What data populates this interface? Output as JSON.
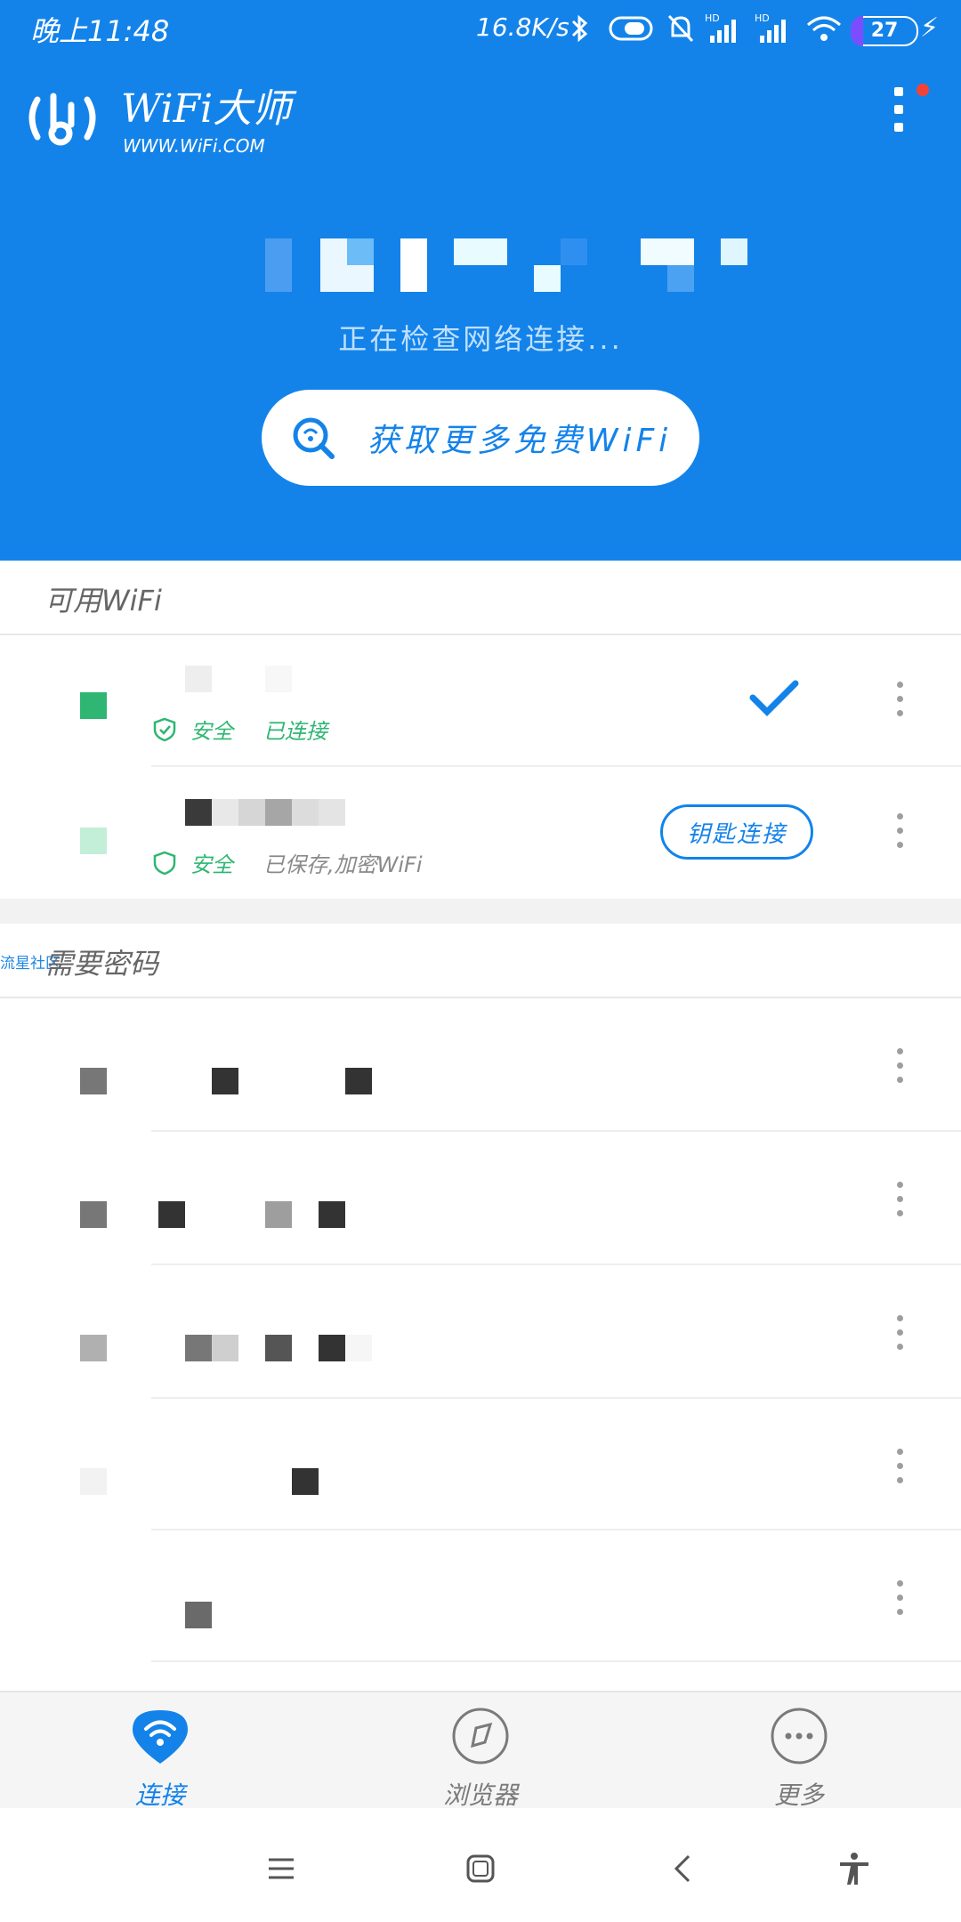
{
  "status_bar": {
    "time": "晚上11:48",
    "net_speed": "16.8K/s",
    "battery_level": "27",
    "icons": [
      "bluetooth-icon",
      "toggle-icon",
      "mute-bell-icon",
      "signal-hd-icon",
      "signal-hd-icon",
      "wifi-icon",
      "battery-icon",
      "charging-icon"
    ]
  },
  "app": {
    "brand": "WiFi大师",
    "url": "WWW.WiFi.COM",
    "checking_text": "正在检查网络连接...",
    "get_more_label": "获取更多免费WiFi"
  },
  "available": {
    "title": "可用WiFi",
    "rows": [
      {
        "status_safe": "安全",
        "status_state": "已连接",
        "connected": true
      },
      {
        "status_safe": "安全",
        "status_state": "已保存,加密WiFi",
        "action_label": "钥匙连接"
      }
    ]
  },
  "password_required": {
    "title": "需要密码",
    "row_count": 5
  },
  "watermark": "流星社区",
  "bottom_nav": {
    "items": [
      {
        "label": "连接",
        "icon": "wifi-icon",
        "active": true
      },
      {
        "label": "浏览器",
        "icon": "compass-icon",
        "active": false
      },
      {
        "label": "更多",
        "icon": "more-icon",
        "active": false
      }
    ]
  },
  "colors": {
    "accent": "#1383ea",
    "safe_green": "#2fb672",
    "header_bg": "#1383ea"
  }
}
